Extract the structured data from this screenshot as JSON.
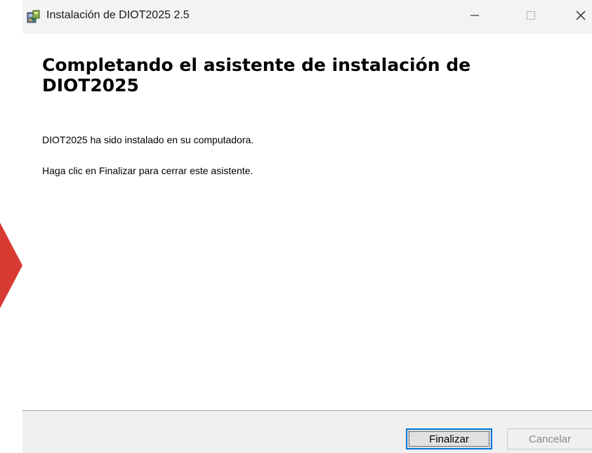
{
  "window": {
    "title": "Instalación de DIOT2025 2.5",
    "icon": "installer-package-icon",
    "controls": {
      "minimize": "minimize-icon",
      "maximize": "maximize-icon",
      "close": "close-icon"
    }
  },
  "content": {
    "heading": "Completando el asistente de instalación de DIOT2025",
    "line1": "DIOT2025 ha sido instalado en su computadora.",
    "line2": "Haga clic en Finalizar para cerrar este asistente."
  },
  "footer": {
    "finish_label": "Finalizar",
    "cancel_label": "Cancelar"
  },
  "colors": {
    "titlebar": "#f3f3f3",
    "footer": "#f0f0f0",
    "focus_border": "#0078d7",
    "pointer": "#d83a32",
    "disabled_text": "#8a8a8a"
  }
}
